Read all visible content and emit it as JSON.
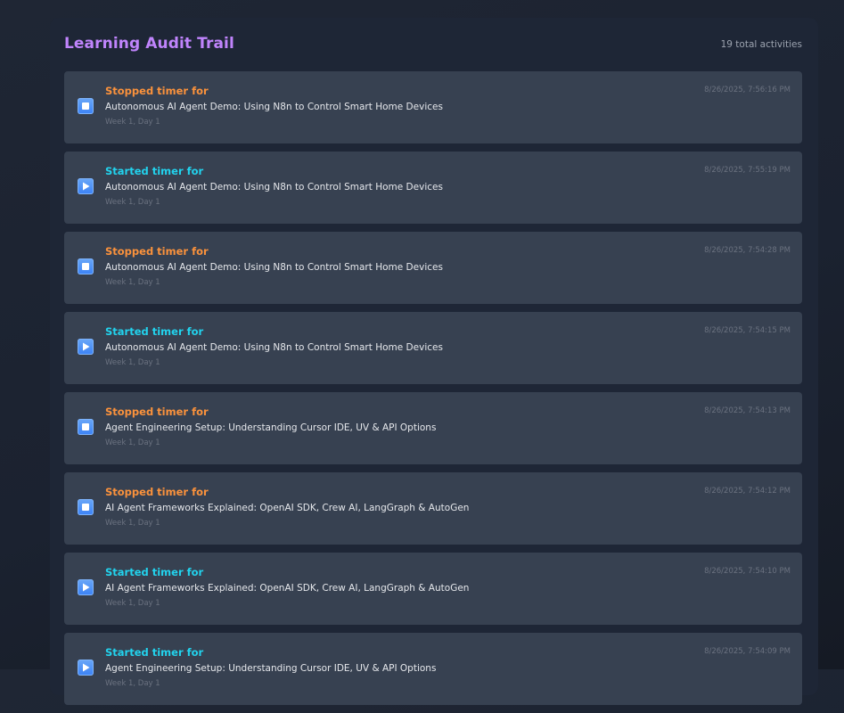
{
  "header": {
    "title": "Learning Audit Trail",
    "total": "19 total activities"
  },
  "activities": [
    {
      "kind": "stopped",
      "action": "Stopped timer for",
      "course": "Autonomous AI Agent Demo: Using N8n to Control Smart Home Devices",
      "meta": "Week 1, Day 1",
      "time": "8/26/2025, 7:56:16 PM",
      "icon": "stop-icon"
    },
    {
      "kind": "started",
      "action": "Started timer for",
      "course": "Autonomous AI Agent Demo: Using N8n to Control Smart Home Devices",
      "meta": "Week 1, Day 1",
      "time": "8/26/2025, 7:55:19 PM",
      "icon": "play-icon"
    },
    {
      "kind": "stopped",
      "action": "Stopped timer for",
      "course": "Autonomous AI Agent Demo: Using N8n to Control Smart Home Devices",
      "meta": "Week 1, Day 1",
      "time": "8/26/2025, 7:54:28 PM",
      "icon": "stop-icon"
    },
    {
      "kind": "started",
      "action": "Started timer for",
      "course": "Autonomous AI Agent Demo: Using N8n to Control Smart Home Devices",
      "meta": "Week 1, Day 1",
      "time": "8/26/2025, 7:54:15 PM",
      "icon": "play-icon"
    },
    {
      "kind": "stopped",
      "action": "Stopped timer for",
      "course": "Agent Engineering Setup: Understanding Cursor IDE, UV & API Options",
      "meta": "Week 1, Day 1",
      "time": "8/26/2025, 7:54:13 PM",
      "icon": "stop-icon"
    },
    {
      "kind": "stopped",
      "action": "Stopped timer for",
      "course": "AI Agent Frameworks Explained: OpenAI SDK, Crew AI, LangGraph & AutoGen",
      "meta": "Week 1, Day 1",
      "time": "8/26/2025, 7:54:12 PM",
      "icon": "stop-icon"
    },
    {
      "kind": "started",
      "action": "Started timer for",
      "course": "AI Agent Frameworks Explained: OpenAI SDK, Crew AI, LangGraph & AutoGen",
      "meta": "Week 1, Day 1",
      "time": "8/26/2025, 7:54:10 PM",
      "icon": "play-icon"
    },
    {
      "kind": "started",
      "action": "Started timer for",
      "course": "Agent Engineering Setup: Understanding Cursor IDE, UV & API Options",
      "meta": "Week 1, Day 1",
      "time": "8/26/2025, 7:54:09 PM",
      "icon": "play-icon"
    }
  ],
  "colors": {
    "title": "#c084fc",
    "stopped": "#fb923c",
    "started": "#22d3ee",
    "card": "#374151",
    "icon": "#3b82f6"
  }
}
